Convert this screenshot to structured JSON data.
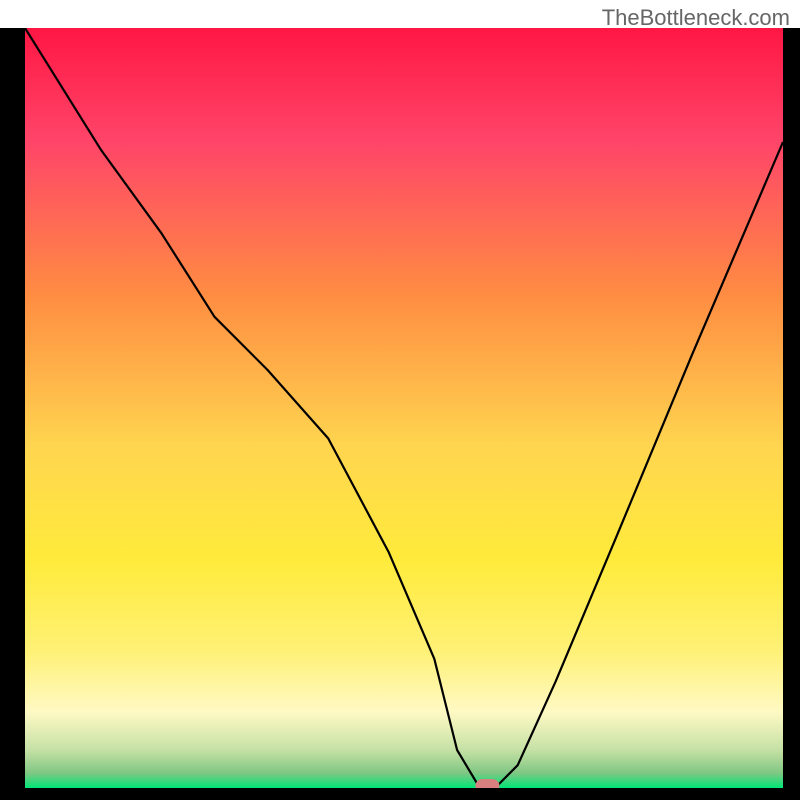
{
  "watermark": "TheBottleneck.com",
  "chart_data": {
    "type": "line",
    "title": "",
    "xlabel": "",
    "ylabel": "",
    "xlim": [
      0,
      100
    ],
    "ylim": [
      0,
      100
    ],
    "gradient_stops": [
      {
        "offset": 0.0,
        "color": "#ff1744"
      },
      {
        "offset": 0.15,
        "color": "#ff4569"
      },
      {
        "offset": 0.35,
        "color": "#ff8c42"
      },
      {
        "offset": 0.55,
        "color": "#ffd54f"
      },
      {
        "offset": 0.7,
        "color": "#ffeb3b"
      },
      {
        "offset": 0.82,
        "color": "#fff176"
      },
      {
        "offset": 0.9,
        "color": "#fff9c4"
      },
      {
        "offset": 0.95,
        "color": "#c5e1a5"
      },
      {
        "offset": 0.98,
        "color": "#81c784"
      },
      {
        "offset": 1.0,
        "color": "#00e676"
      }
    ],
    "series": [
      {
        "name": "bottleneck-curve",
        "x": [
          0,
          5,
          10,
          18,
          25,
          32,
          40,
          48,
          54,
          57,
          60,
          62,
          65,
          70,
          78,
          88,
          100
        ],
        "y": [
          100,
          92,
          84,
          73,
          62,
          55,
          46,
          31,
          17,
          5,
          0,
          0,
          3,
          14,
          33,
          57,
          85
        ]
      }
    ],
    "marker": {
      "x": 61,
      "y": 0
    },
    "axis_color": "#000000"
  }
}
